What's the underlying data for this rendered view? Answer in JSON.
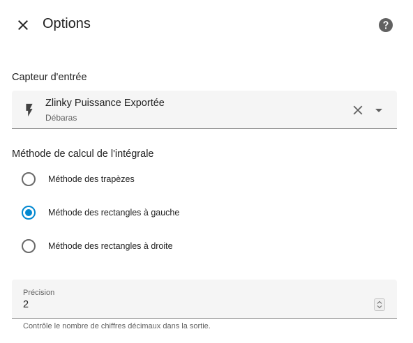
{
  "dialog": {
    "title": "Options",
    "close_icon": "close-icon",
    "help_icon": "help-circle-icon"
  },
  "input_sensor": {
    "label": "Capteur d'entrée",
    "icon": "flash-icon",
    "name": "Zlinky Puissance Exportée",
    "area": "Débaras"
  },
  "integration_method": {
    "label": "Méthode de calcul de l'intégrale",
    "options": [
      {
        "label": "Méthode des trapèzes",
        "checked": false
      },
      {
        "label": "Méthode des rectangles à gauche",
        "checked": true
      },
      {
        "label": "Méthode des rectangles à droite",
        "checked": false
      }
    ]
  },
  "precision": {
    "label": "Précision",
    "value": "2",
    "helper": "Contrôle le nombre de chiffres décimaux dans la sortie."
  },
  "colors": {
    "accent": "#0288d1",
    "field_bg": "#f5f5f5",
    "text_primary": "#212121",
    "text_secondary": "#616161"
  }
}
